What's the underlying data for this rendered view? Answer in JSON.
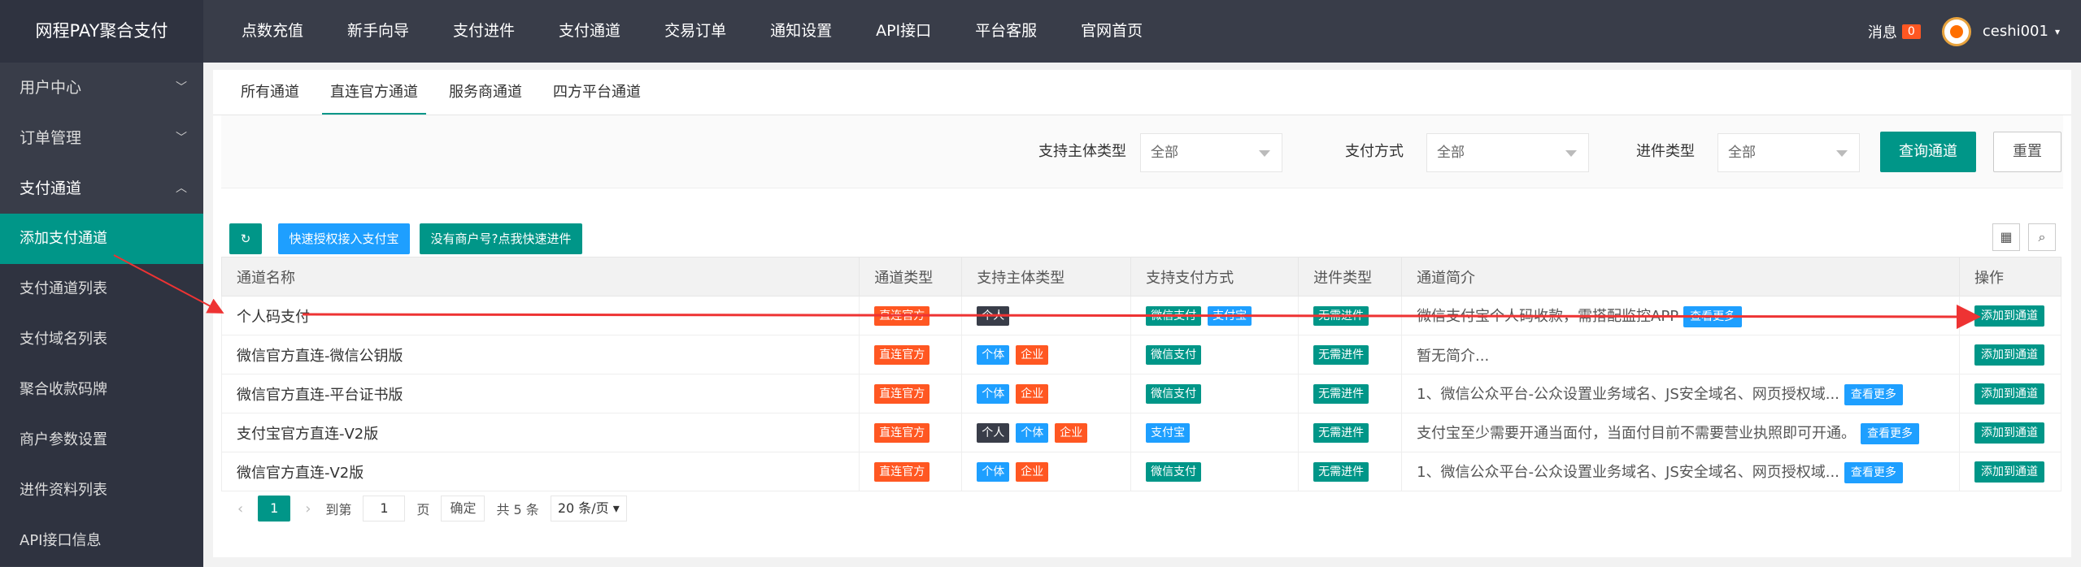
{
  "header": {
    "brand": "网程PAY聚合支付",
    "nav": [
      "点数充值",
      "新手向导",
      "支付进件",
      "支付通道",
      "交易订单",
      "通知设置",
      "API接口",
      "平台客服",
      "官网首页"
    ],
    "msg_label": "消息",
    "msg_count": "0",
    "username": "ceshi001"
  },
  "sidebar": {
    "groups": [
      "用户中心",
      "订单管理",
      "支付通道"
    ],
    "sub": [
      "添加支付通道",
      "支付通道列表",
      "支付域名列表",
      "聚合收款码牌",
      "商户参数设置",
      "进件资料列表",
      "API接口信息"
    ]
  },
  "tabs": [
    "所有通道",
    "直连官方通道",
    "服务商通道",
    "四方平台通道"
  ],
  "filters": {
    "subject_label": "支持主体类型",
    "subject_value": "全部",
    "pay_label": "支付方式",
    "pay_value": "全部",
    "entry_label": "进件类型",
    "entry_value": "全部",
    "query": "查询通道",
    "reset": "重置"
  },
  "toolbar": {
    "refresh_icon": "↻",
    "alipay_btn": "快速授权接入支付宝",
    "no_merchant_btn": "没有商户号?点我快速进件"
  },
  "table": {
    "headers": [
      "通道名称",
      "通道类型",
      "支持主体类型",
      "支持支付方式",
      "进件类型",
      "通道简介",
      "操作"
    ],
    "rows": [
      {
        "name": "个人码支付",
        "type": "直连官方",
        "subjects": [
          "个人"
        ],
        "methods": [
          "微信支付",
          "支付宝"
        ],
        "entry": "无需进件",
        "desc": "微信支付宝个人码收款，需搭配监控APP",
        "more": "查看更多",
        "action": "添加到通道"
      },
      {
        "name": "微信官方直连-微信公钥版",
        "type": "直连官方",
        "subjects": [
          "个体",
          "企业"
        ],
        "methods": [
          "微信支付"
        ],
        "entry": "无需进件",
        "desc": "暂无简介...",
        "more": "",
        "action": "添加到通道"
      },
      {
        "name": "微信官方直连-平台证书版",
        "type": "直连官方",
        "subjects": [
          "个体",
          "企业"
        ],
        "methods": [
          "微信支付"
        ],
        "entry": "无需进件",
        "desc": "1、微信公众平台-公众设置业务域名、JS安全域名、网页授权域...",
        "more": "查看更多",
        "action": "添加到通道"
      },
      {
        "name": "支付宝官方直连-V2版",
        "type": "直连官方",
        "subjects": [
          "个人",
          "个体",
          "企业"
        ],
        "methods": [
          "支付宝"
        ],
        "entry": "无需进件",
        "desc": "支付宝至少需要开通当面付，当面付目前不需要营业执照即可开通。",
        "more": "查看更多",
        "action": "添加到通道"
      },
      {
        "name": "微信官方直连-V2版",
        "type": "直连官方",
        "subjects": [
          "个体",
          "企业"
        ],
        "methods": [
          "微信支付"
        ],
        "entry": "无需进件",
        "desc": "1、微信公众平台-公众设置业务域名、JS安全域名、网页授权域...",
        "more": "查看更多",
        "action": "添加到通道"
      }
    ]
  },
  "pager": {
    "current": "1",
    "goto_label": "到第",
    "goto_value": "1",
    "page_label": "页",
    "ok": "确定",
    "total": "共 5 条",
    "size": "20 条/页"
  },
  "colors": {
    "primary": "#009688",
    "dark": "#393d49",
    "orange": "#ff5722",
    "blue": "#1e9fff",
    "annotation": "#ee3333"
  }
}
